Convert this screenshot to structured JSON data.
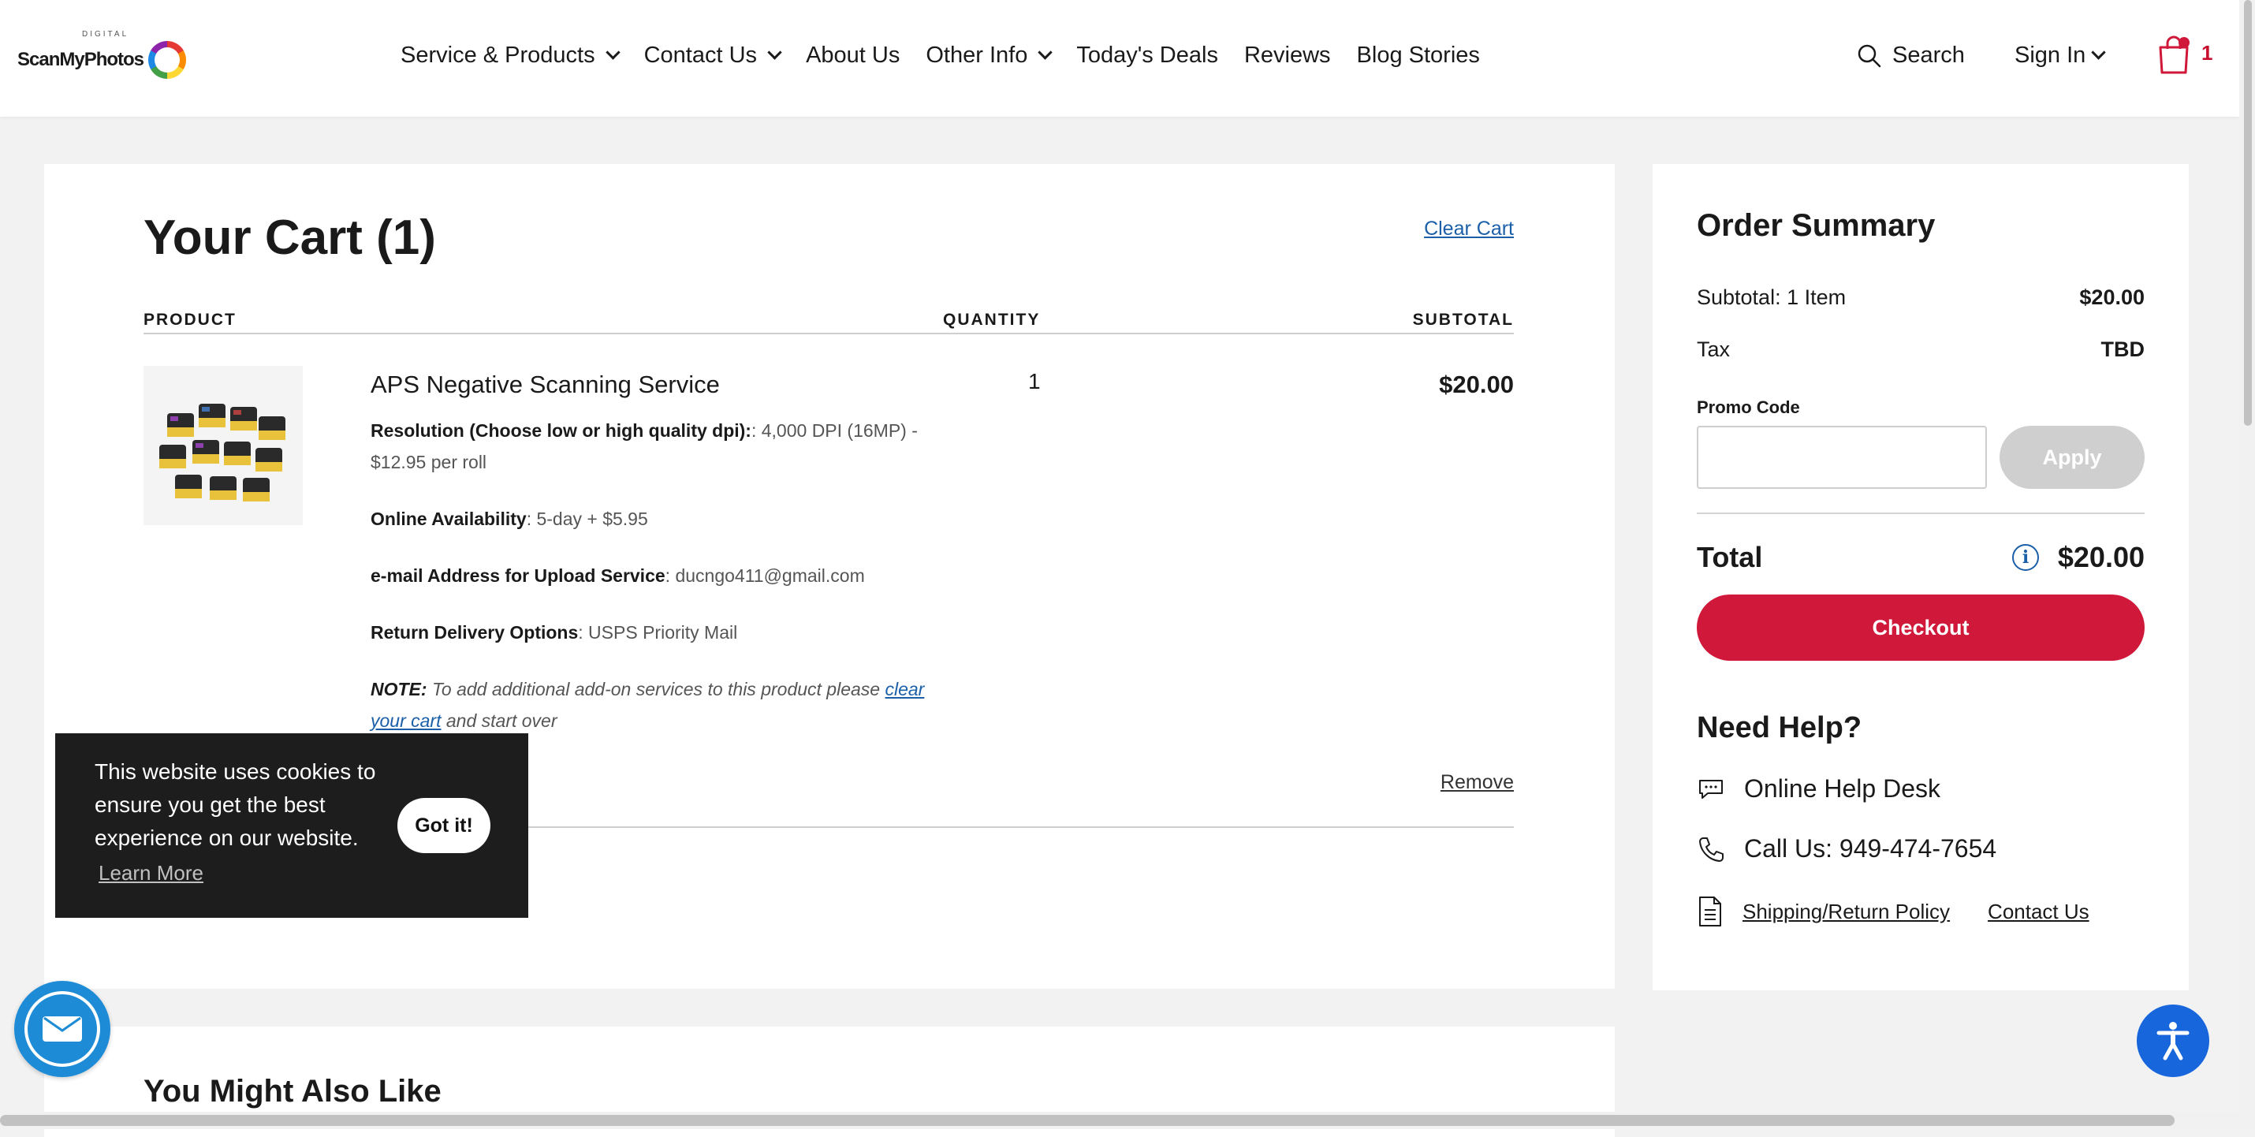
{
  "header": {
    "logo_text": "ScanMyPhotos",
    "logo_sub": "DIGITAL",
    "nav": [
      {
        "label": "Service & Products",
        "has_dropdown": true
      },
      {
        "label": "Contact Us",
        "has_dropdown": true
      },
      {
        "label": "About Us",
        "has_dropdown": false
      },
      {
        "label": "Other Info",
        "has_dropdown": true
      },
      {
        "label": "Today's Deals",
        "has_dropdown": false
      },
      {
        "label": "Reviews",
        "has_dropdown": false
      },
      {
        "label": "Blog Stories",
        "has_dropdown": false
      }
    ],
    "search_label": "Search",
    "signin_label": "Sign In",
    "cart_count": "1"
  },
  "cart": {
    "title": "Your Cart (1)",
    "clear_cart": "Clear Cart",
    "columns": {
      "product": "PRODUCT",
      "quantity": "QUANTITY",
      "subtotal": "SUBTOTAL"
    },
    "item": {
      "name": "APS Negative Scanning Service",
      "quantity": "1",
      "price": "$20.00",
      "options": [
        {
          "label": "Resolution (Choose low or high quality dpi):",
          "value": ": 4,000 DPI (16MP) - $12.95 per roll"
        },
        {
          "label": "Online Availability",
          "value": ": 5-day + $5.95"
        },
        {
          "label": "e-mail Address for Upload Service",
          "value": ": ducngo411@gmail.com"
        },
        {
          "label": "Return Delivery Options",
          "value": ": USPS Priority Mail"
        }
      ],
      "note_label": "NOTE:",
      "note_text": " To add additional add-on services to this product please ",
      "note_link": "clear your cart",
      "note_end": " and start over",
      "remove": "Remove"
    }
  },
  "summary": {
    "title": "Order Summary",
    "subtotal_label": "Subtotal: 1 Item",
    "subtotal_value": "$20.00",
    "tax_label": "Tax",
    "tax_value": "TBD",
    "promo_label": "Promo Code",
    "promo_placeholder": "",
    "apply": "Apply",
    "total_label": "Total",
    "total_value": "$20.00",
    "checkout": "Checkout",
    "help_title": "Need Help?",
    "help_desk": "Online Help Desk",
    "call": "Call Us: 949-474-7654",
    "shipping_policy": "Shipping/Return Policy",
    "contact_us": "Contact Us"
  },
  "also": {
    "title": "You Might Also Like"
  },
  "cookie": {
    "text": "This website uses cookies to ensure you get the best experience on our website.",
    "learn_more": "Learn More",
    "got_it": "Got it!"
  },
  "colors": {
    "accent_red": "#d0193a",
    "link_blue": "#1a5fa8",
    "access_blue": "#1766dc",
    "mail_blue": "#1d8bd6"
  },
  "icons": {
    "search": "search-icon",
    "cart": "shopping-bag-icon",
    "info": "info-icon",
    "chat": "chat-bubble-icon",
    "phone": "phone-icon",
    "document": "document-icon",
    "mail": "mail-icon",
    "accessibility": "accessibility-icon"
  }
}
